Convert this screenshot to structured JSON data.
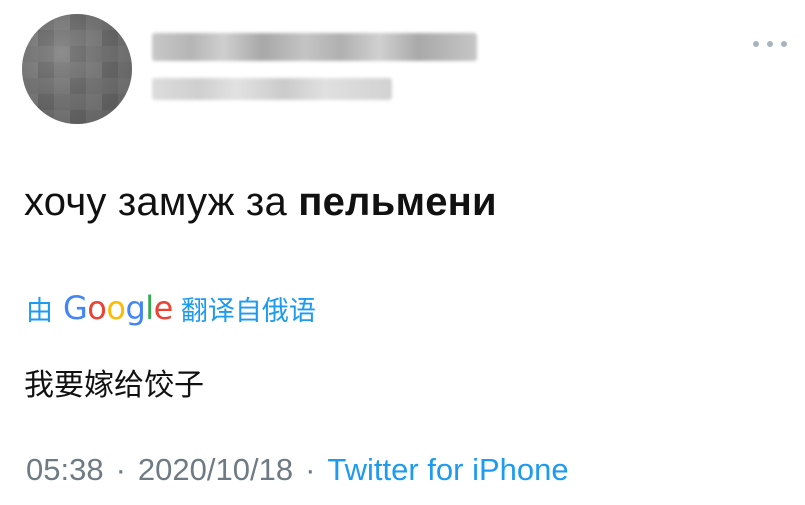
{
  "author": {
    "avatar": "blurred-avatar",
    "name": "",
    "handle": ""
  },
  "more_icon": "more-horizontal-icon",
  "tweet": {
    "text_regular": "хочу замуж за ",
    "text_bold": "пельмени"
  },
  "translation": {
    "prefix": "由",
    "google_letters": [
      "G",
      "o",
      "o",
      "g",
      "l",
      "e"
    ],
    "google_colors": [
      "#4285f4",
      "#ea4335",
      "#fbbc05",
      "#4285f4",
      "#34a853",
      "#ea4335"
    ],
    "suffix": "翻译自俄语",
    "text": "我要嫁给饺子"
  },
  "meta": {
    "time": "05:38",
    "separator": "·",
    "date": "2020/10/18",
    "source": "Twitter for iPhone"
  },
  "colors": {
    "link": "#1d9bf0",
    "muted": "#6e7b85",
    "text": "#111111"
  }
}
